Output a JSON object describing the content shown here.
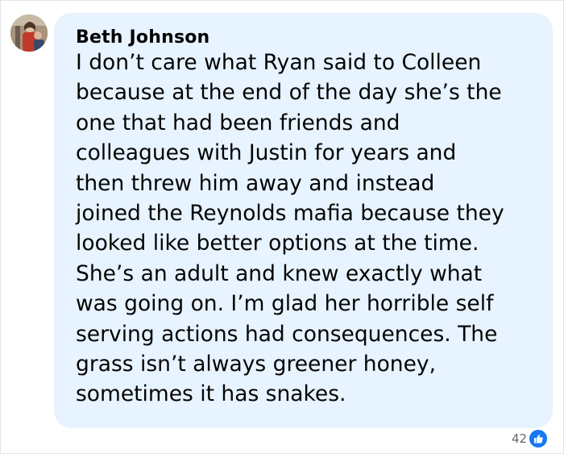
{
  "comment": {
    "author": "Beth Johnson",
    "lines": [
      "I don’t care what Ryan said to Colleen",
      "because at the end of the day she’s the",
      "one that had been friends and",
      "colleagues with Justin for years and",
      "then threw him away and instead",
      "joined the Reynolds mafia because they",
      "looked like better options at the time.",
      "She’s an adult and knew exactly what",
      "was going on. I’m glad her horrible self",
      "serving actions had consequences. The",
      "grass isn’t always greener honey,",
      "sometimes it has snakes."
    ],
    "reaction_count": "42",
    "reaction_icon": "like-icon"
  },
  "colors": {
    "bubble_background": "#e7f3ff",
    "text": "#050505",
    "like_blue": "#1877f2",
    "secondary_text": "#65676b"
  }
}
